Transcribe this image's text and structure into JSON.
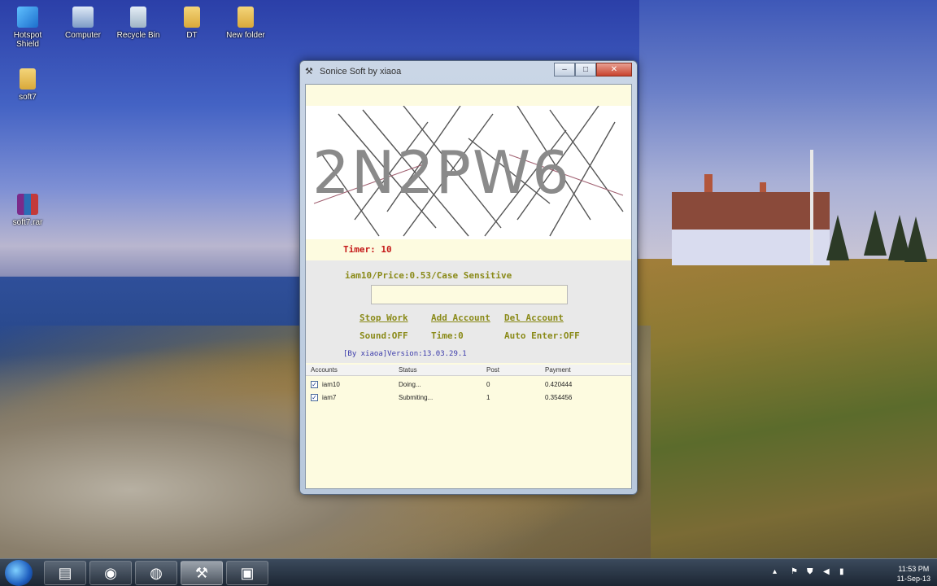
{
  "desktop": {
    "icons": [
      {
        "label": "Hotspot Shield"
      },
      {
        "label": "Computer"
      },
      {
        "label": "Recycle Bin"
      },
      {
        "label": "DT"
      },
      {
        "label": "New folder"
      },
      {
        "label": "soft7"
      },
      {
        "label": "soft7.rar"
      }
    ]
  },
  "window": {
    "title": "Sonice Soft by xiaoa",
    "captcha_text": "2N2PW6",
    "timer": "Timer: 10",
    "info": "iam10/Price:0.53/Case Sensitive",
    "answer_value": "",
    "stop_work": "Stop Work",
    "add_account": "Add Account",
    "del_account": "Del Account",
    "sound": "Sound:OFF",
    "time": "Time:0",
    "auto_enter": "Auto Enter:OFF",
    "version": "[By xiaoa]Version:13.03.29.1",
    "table": {
      "headers": [
        "Accounts",
        "Status",
        "Post",
        "Payment"
      ],
      "rows": [
        {
          "account": "iam10",
          "status": "Doing...",
          "post": "0",
          "payment": "0.420444"
        },
        {
          "account": "iam7",
          "status": "Submiting...",
          "post": "1",
          "payment": "0.354456"
        }
      ]
    }
  },
  "taskbar": {
    "time": "11:53 PM",
    "date": "11-Sep-13"
  }
}
